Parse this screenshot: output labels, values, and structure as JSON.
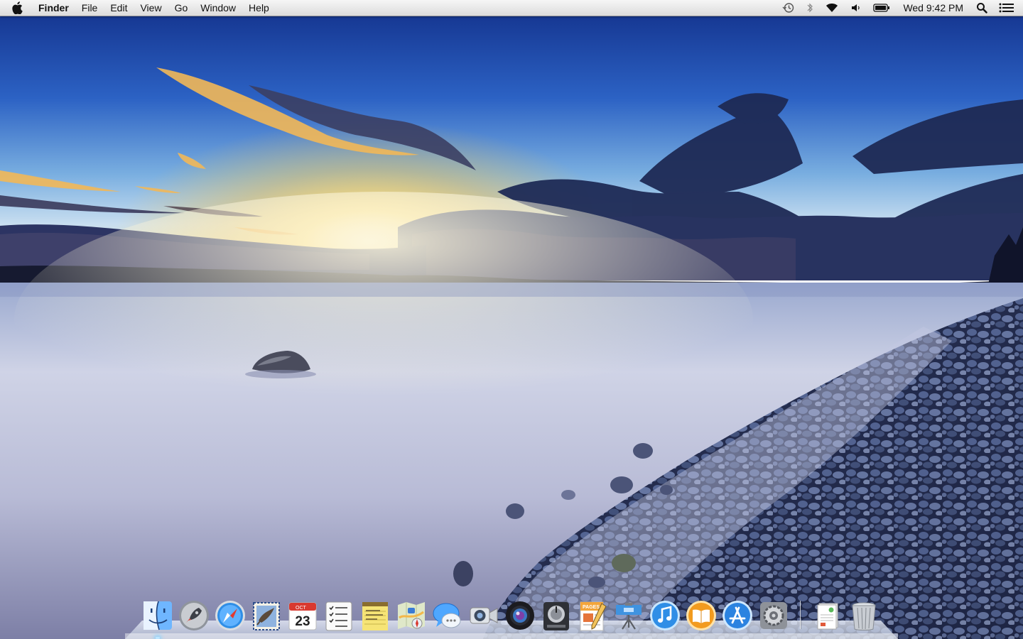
{
  "menubar": {
    "apple_icon": "apple-logo-icon",
    "app_name": "Finder",
    "menus": [
      "File",
      "Edit",
      "View",
      "Go",
      "Window",
      "Help"
    ],
    "status_icons": [
      "time-machine-icon",
      "bluetooth-icon",
      "wifi-icon",
      "volume-icon",
      "battery-icon"
    ],
    "clock": "Wed 9:42 PM",
    "spotlight_icon": "spotlight-search-icon",
    "notification_icon": "notification-center-icon"
  },
  "desktop": {
    "wallpaper": "lake-sunset-pebble-shore",
    "colors": {
      "sky_top": "#1c3f9c",
      "sun": "#ffd860",
      "water": "#c9cde3"
    }
  },
  "dock": {
    "apps": [
      {
        "name": "Finder",
        "icon": "finder-icon",
        "running": true
      },
      {
        "name": "Launchpad",
        "icon": "launchpad-icon",
        "running": false
      },
      {
        "name": "Safari",
        "icon": "safari-icon",
        "running": false
      },
      {
        "name": "Mail",
        "icon": "mail-icon",
        "running": false
      },
      {
        "name": "Calendar",
        "icon": "calendar-icon",
        "running": false,
        "month": "OCT",
        "day": "23"
      },
      {
        "name": "Reminders",
        "icon": "reminders-icon",
        "running": false
      },
      {
        "name": "Notes",
        "icon": "notes-icon",
        "running": false
      },
      {
        "name": "Maps",
        "icon": "maps-icon",
        "running": false
      },
      {
        "name": "Messages",
        "icon": "messages-icon",
        "running": false
      },
      {
        "name": "FaceTime",
        "icon": "facetime-icon",
        "running": false
      },
      {
        "name": "Photo Booth",
        "icon": "photo-booth-icon",
        "running": false
      },
      {
        "name": "Logic Pro",
        "icon": "logic-pro-icon",
        "running": false
      },
      {
        "name": "Pages",
        "icon": "pages-icon",
        "running": false,
        "label": "PAGES"
      },
      {
        "name": "Keynote",
        "icon": "keynote-icon",
        "running": false
      },
      {
        "name": "iTunes",
        "icon": "itunes-icon",
        "running": false
      },
      {
        "name": "iBooks",
        "icon": "ibooks-icon",
        "running": false
      },
      {
        "name": "App Store",
        "icon": "app-store-icon",
        "running": false
      },
      {
        "name": "System Preferences",
        "icon": "system-preferences-icon",
        "running": false
      }
    ],
    "extras": [
      {
        "name": "Downloads stack",
        "icon": "document-stack-icon"
      },
      {
        "name": "Trash",
        "icon": "trash-icon"
      }
    ]
  }
}
